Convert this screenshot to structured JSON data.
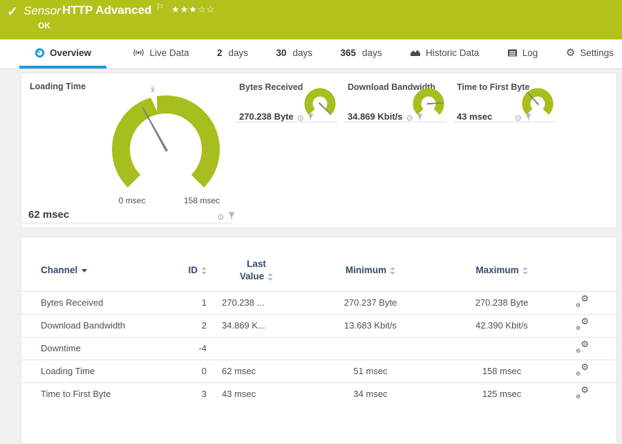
{
  "header": {
    "check_icon": "✓",
    "kind": "Sensor",
    "title": "HTTP Advanced",
    "flag_icon": "⚐",
    "stars": "★★★☆☆",
    "status": "OK"
  },
  "tabs": [
    {
      "label": "Overview",
      "active": true
    },
    {
      "label": "Live Data"
    },
    {
      "num": "2",
      "label": "days"
    },
    {
      "num": "30",
      "label": "days"
    },
    {
      "num": "365",
      "label": "days"
    },
    {
      "label": "Historic Data"
    },
    {
      "label": "Log"
    },
    {
      "label": "Settings"
    }
  ],
  "icons": {
    "gear": "⚙"
  },
  "gauges": {
    "arc_color": "#a8bd1e",
    "needle_color": "#7d7d7d",
    "primary": {
      "title": "Loading Time",
      "value": "62 msec",
      "scale_min": "0 msec",
      "scale_max": "158 msec",
      "avg_marker": "x̄",
      "needle_angle_deg": -29,
      "avg_angle_deg": -13
    },
    "secondary": [
      {
        "title": "Bytes Received",
        "value": "270.238 Byte",
        "needle_angle_deg": 135
      },
      {
        "title": "Download Bandwidth",
        "value": "34.869 Kbit/s",
        "needle_angle_deg": 87
      },
      {
        "title": "Time to First Byte",
        "value": "43 msec",
        "needle_angle_deg": -42
      }
    ]
  },
  "table": {
    "headers": {
      "channel": "Channel",
      "id": "ID",
      "last_line1": "Last",
      "last_line2": "Value",
      "min": "Minimum",
      "max": "Maximum"
    },
    "rows": [
      {
        "channel": "Bytes Received",
        "id": "1",
        "last": "270.238 ...",
        "min": "270.237 Byte",
        "max": "270.238 Byte"
      },
      {
        "channel": "Download Bandwidth",
        "id": "2",
        "last": "34.869 K...",
        "min": "13.683 Kbit/s",
        "max": "42.390 Kbit/s"
      },
      {
        "channel": "Downtime",
        "id": "-4",
        "last": "",
        "min": "",
        "max": ""
      },
      {
        "channel": "Loading Time",
        "id": "0",
        "last": "62 msec",
        "min": "51 msec",
        "max": "158 msec"
      },
      {
        "channel": "Time to First Byte",
        "id": "3",
        "last": "43 msec",
        "min": "34 msec",
        "max": "125 msec"
      }
    ]
  },
  "colors": {
    "brand_green": "#b2c21b",
    "active_tab_blue": "#1d9bd7",
    "header_navy": "#32496b"
  }
}
